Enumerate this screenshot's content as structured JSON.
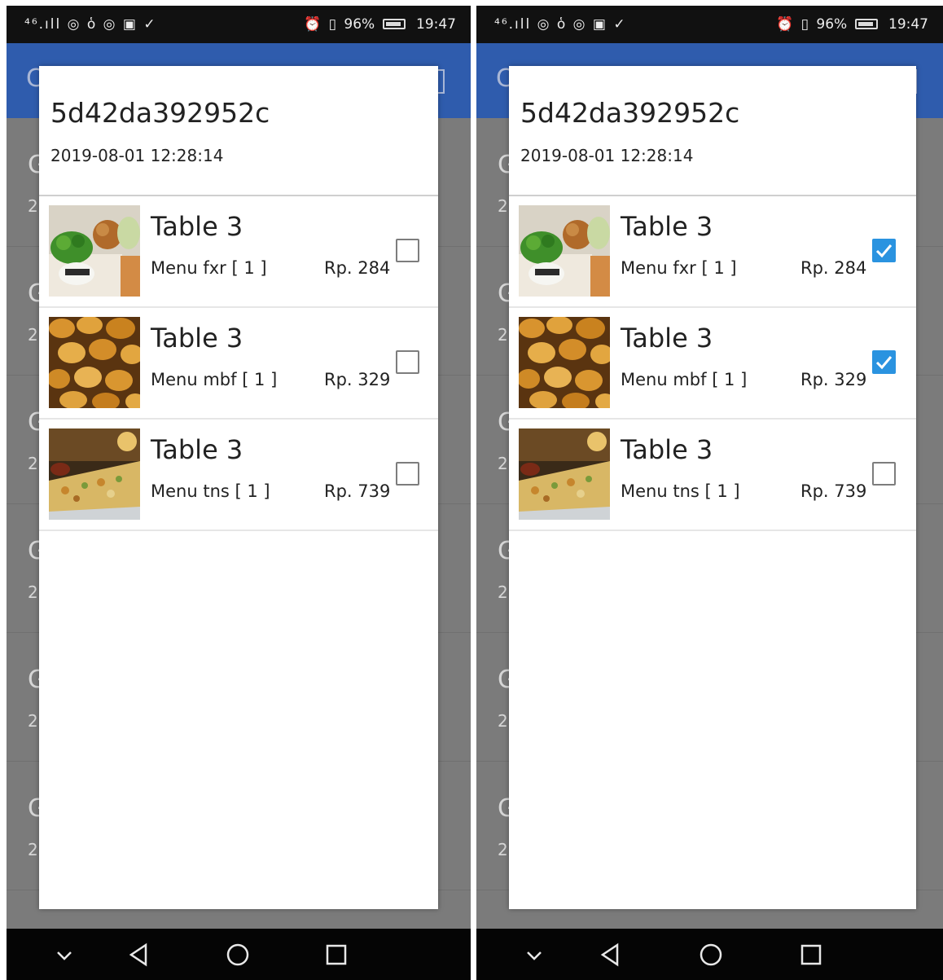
{
  "screens": [
    {
      "status": {
        "left_icons": "⁴⁶.ıll ◎ ὁ ◎ ▣ ✓",
        "alarm": "⏰",
        "vibrate": "▯",
        "battery": "96%",
        "time": "19:47"
      },
      "dialog": {
        "order_id": "5d42da392952c",
        "date": "2019-08-01 12:28:14",
        "items": [
          {
            "table": "Table 3",
            "menu": "Menu fxr [ 1 ]",
            "price": "Rp. 284",
            "checked": false
          },
          {
            "table": "Table 3",
            "menu": "Menu mbf [ 1 ]",
            "price": "Rp. 329",
            "checked": false
          },
          {
            "table": "Table 3",
            "menu": "Menu tns [ 1 ]",
            "price": "Rp. 739",
            "checked": false
          }
        ]
      },
      "background_rows": [
        {
          "letter": "G",
          "num": "2"
        },
        {
          "letter": "G",
          "num": "2"
        },
        {
          "letter": "G",
          "num": "2"
        },
        {
          "letter": "G",
          "num": "2"
        },
        {
          "letter": "G",
          "num": "2"
        },
        {
          "letter": "G",
          "num": "2"
        }
      ]
    },
    {
      "status": {
        "left_icons": "⁴⁶.ıll ◎ ὁ ◎ ▣ ✓",
        "alarm": "⏰",
        "vibrate": "▯",
        "battery": "96%",
        "time": "19:47"
      },
      "dialog": {
        "order_id": "5d42da392952c",
        "date": "2019-08-01 12:28:14",
        "items": [
          {
            "table": "Table 3",
            "menu": "Menu fxr [ 1 ]",
            "price": "Rp. 284",
            "checked": true
          },
          {
            "table": "Table 3",
            "menu": "Menu mbf [ 1 ]",
            "price": "Rp. 329",
            "checked": true
          },
          {
            "table": "Table 3",
            "menu": "Menu tns [ 1 ]",
            "price": "Rp. 739",
            "checked": false
          }
        ]
      },
      "background_rows": [
        {
          "letter": "G",
          "num": "2"
        },
        {
          "letter": "G",
          "num": "2"
        },
        {
          "letter": "G",
          "num": "2"
        },
        {
          "letter": "G",
          "num": "2"
        },
        {
          "letter": "G",
          "num": "2"
        },
        {
          "letter": "G",
          "num": "2"
        }
      ]
    }
  ],
  "theme": {
    "appbar": "#2f5cad",
    "check_accent": "#2a93e0",
    "scrim": "#7b7b7b",
    "navbar": "#050505"
  },
  "nav": [
    "chevron-down-icon",
    "back-icon",
    "home-icon",
    "recents-icon"
  ],
  "food_images": [
    "bento-box-image",
    "bread-rolls-image",
    "pizza-bread-image"
  ]
}
